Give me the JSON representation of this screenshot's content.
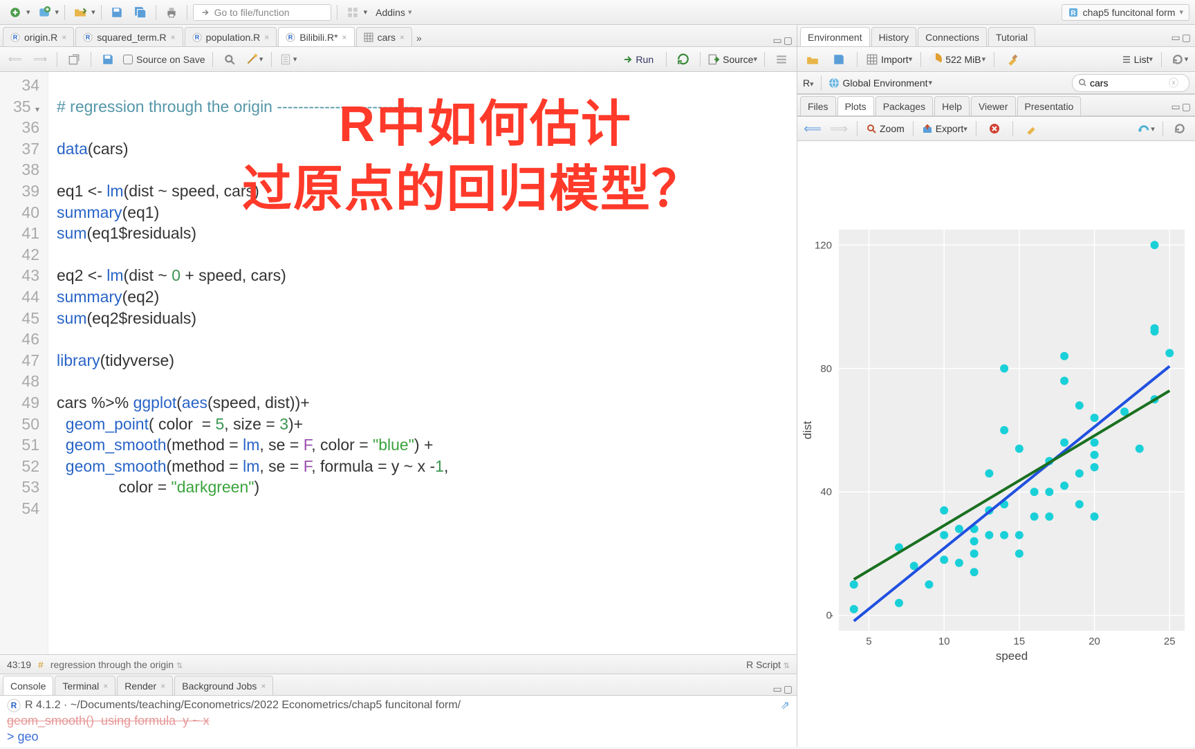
{
  "toolbar": {
    "goto_placeholder": "Go to file/function",
    "addins_label": "Addins",
    "project_name": "chap5 funcitonal form"
  },
  "editor": {
    "tabs": [
      {
        "label": "origin.R",
        "active": false,
        "dirty": false,
        "icon": "r"
      },
      {
        "label": "squared_term.R",
        "active": false,
        "dirty": false,
        "icon": "r"
      },
      {
        "label": "population.R",
        "active": false,
        "dirty": false,
        "icon": "r"
      },
      {
        "label": "Bilibili.R*",
        "active": true,
        "dirty": true,
        "icon": "r"
      },
      {
        "label": "cars",
        "active": false,
        "dirty": false,
        "icon": "table"
      }
    ],
    "source_on_save": "Source on Save",
    "run_label": "Run",
    "source_label": "Source",
    "cursor_pos": "43:19",
    "section_label": "regression through the origin",
    "language": "R Script",
    "line_start": 34,
    "code": [
      {
        "n": 34,
        "t": ""
      },
      {
        "n": 35,
        "t": "# regression through the origin --------------------------",
        "cls": "comment",
        "fold": true
      },
      {
        "n": 36,
        "t": ""
      },
      {
        "n": 37,
        "t": "data(cars)"
      },
      {
        "n": 38,
        "t": ""
      },
      {
        "n": 39,
        "t": "eq1 <- lm(dist ~ speed, cars)"
      },
      {
        "n": 40,
        "t": "summary(eq1)"
      },
      {
        "n": 41,
        "t": "sum(eq1$residuals)"
      },
      {
        "n": 42,
        "t": ""
      },
      {
        "n": 43,
        "t": "eq2 <- lm(dist ~ 0 + speed, cars)"
      },
      {
        "n": 44,
        "t": "summary(eq2)"
      },
      {
        "n": 45,
        "t": "sum(eq2$residuals)"
      },
      {
        "n": 46,
        "t": ""
      },
      {
        "n": 47,
        "t": "library(tidyverse)"
      },
      {
        "n": 48,
        "t": ""
      },
      {
        "n": 49,
        "t": "cars %>% ggplot(aes(speed, dist))+"
      },
      {
        "n": 50,
        "t": "  geom_point( color  = 5, size = 3)+"
      },
      {
        "n": 51,
        "t": "  geom_smooth(method = lm, se = F, color = \"blue\") +"
      },
      {
        "n": 52,
        "t": "  geom_smooth(method = lm, se = F, formula = y ~ x -1,"
      },
      {
        "n": 53,
        "t": "              color = \"darkgreen\")"
      },
      {
        "n": 54,
        "t": ""
      }
    ]
  },
  "overlay": {
    "line1": "R中如何估计",
    "line2": "过原点的回归模型？"
  },
  "console": {
    "tabs": [
      "Console",
      "Terminal",
      "Render",
      "Background Jobs"
    ],
    "path_prefix": "R 4.1.2 · ",
    "path": "~/Documents/teaching/Econometrics/2022 Econometrics/chap5 funcitonal form/",
    "scroll_line": "geom_smooth()  using formula  y ~ x",
    "prompt": "> ",
    "typed": "geo"
  },
  "env": {
    "tabs": [
      "Environment",
      "History",
      "Connections",
      "Tutorial"
    ],
    "import_label": "Import",
    "mem": "522 MiB",
    "list_label": "List",
    "scope_r": "R",
    "scope_global": "Global Environment",
    "search_value": "cars"
  },
  "plots": {
    "tabs": [
      "Files",
      "Plots",
      "Packages",
      "Help",
      "Viewer",
      "Presentatio"
    ],
    "zoom_label": "Zoom",
    "export_label": "Export"
  },
  "chart_data": {
    "type": "scatter",
    "xlabel": "speed",
    "ylabel": "dist",
    "xlim": [
      3,
      26
    ],
    "ylim": [
      -5,
      125
    ],
    "xticks": [
      5,
      10,
      15,
      20,
      25
    ],
    "yticks": [
      0,
      40,
      80,
      120
    ],
    "series": [
      {
        "name": "points",
        "type": "scatter",
        "color": "#1ad0d8",
        "x": [
          4,
          4,
          7,
          7,
          8,
          9,
          10,
          10,
          10,
          11,
          11,
          12,
          12,
          12,
          12,
          13,
          13,
          13,
          13,
          14,
          14,
          14,
          14,
          15,
          15,
          15,
          16,
          16,
          17,
          17,
          17,
          18,
          18,
          18,
          18,
          19,
          19,
          19,
          20,
          20,
          20,
          20,
          20,
          22,
          23,
          24,
          24,
          24,
          24,
          25
        ],
        "y": [
          2,
          10,
          4,
          22,
          16,
          10,
          18,
          26,
          34,
          17,
          28,
          14,
          20,
          24,
          28,
          26,
          34,
          34,
          46,
          26,
          36,
          60,
          80,
          20,
          26,
          54,
          32,
          40,
          32,
          40,
          50,
          42,
          56,
          76,
          84,
          36,
          46,
          68,
          32,
          48,
          52,
          56,
          64,
          66,
          54,
          70,
          92,
          93,
          120,
          85
        ]
      },
      {
        "name": "lm-with-intercept",
        "type": "line",
        "color": "blue",
        "x": [
          4,
          25
        ],
        "y": [
          -1.85,
          80.73
        ]
      },
      {
        "name": "lm-through-origin",
        "type": "line",
        "color": "darkgreen",
        "x": [
          4,
          25
        ],
        "y": [
          11.64,
          72.77
        ]
      }
    ]
  }
}
